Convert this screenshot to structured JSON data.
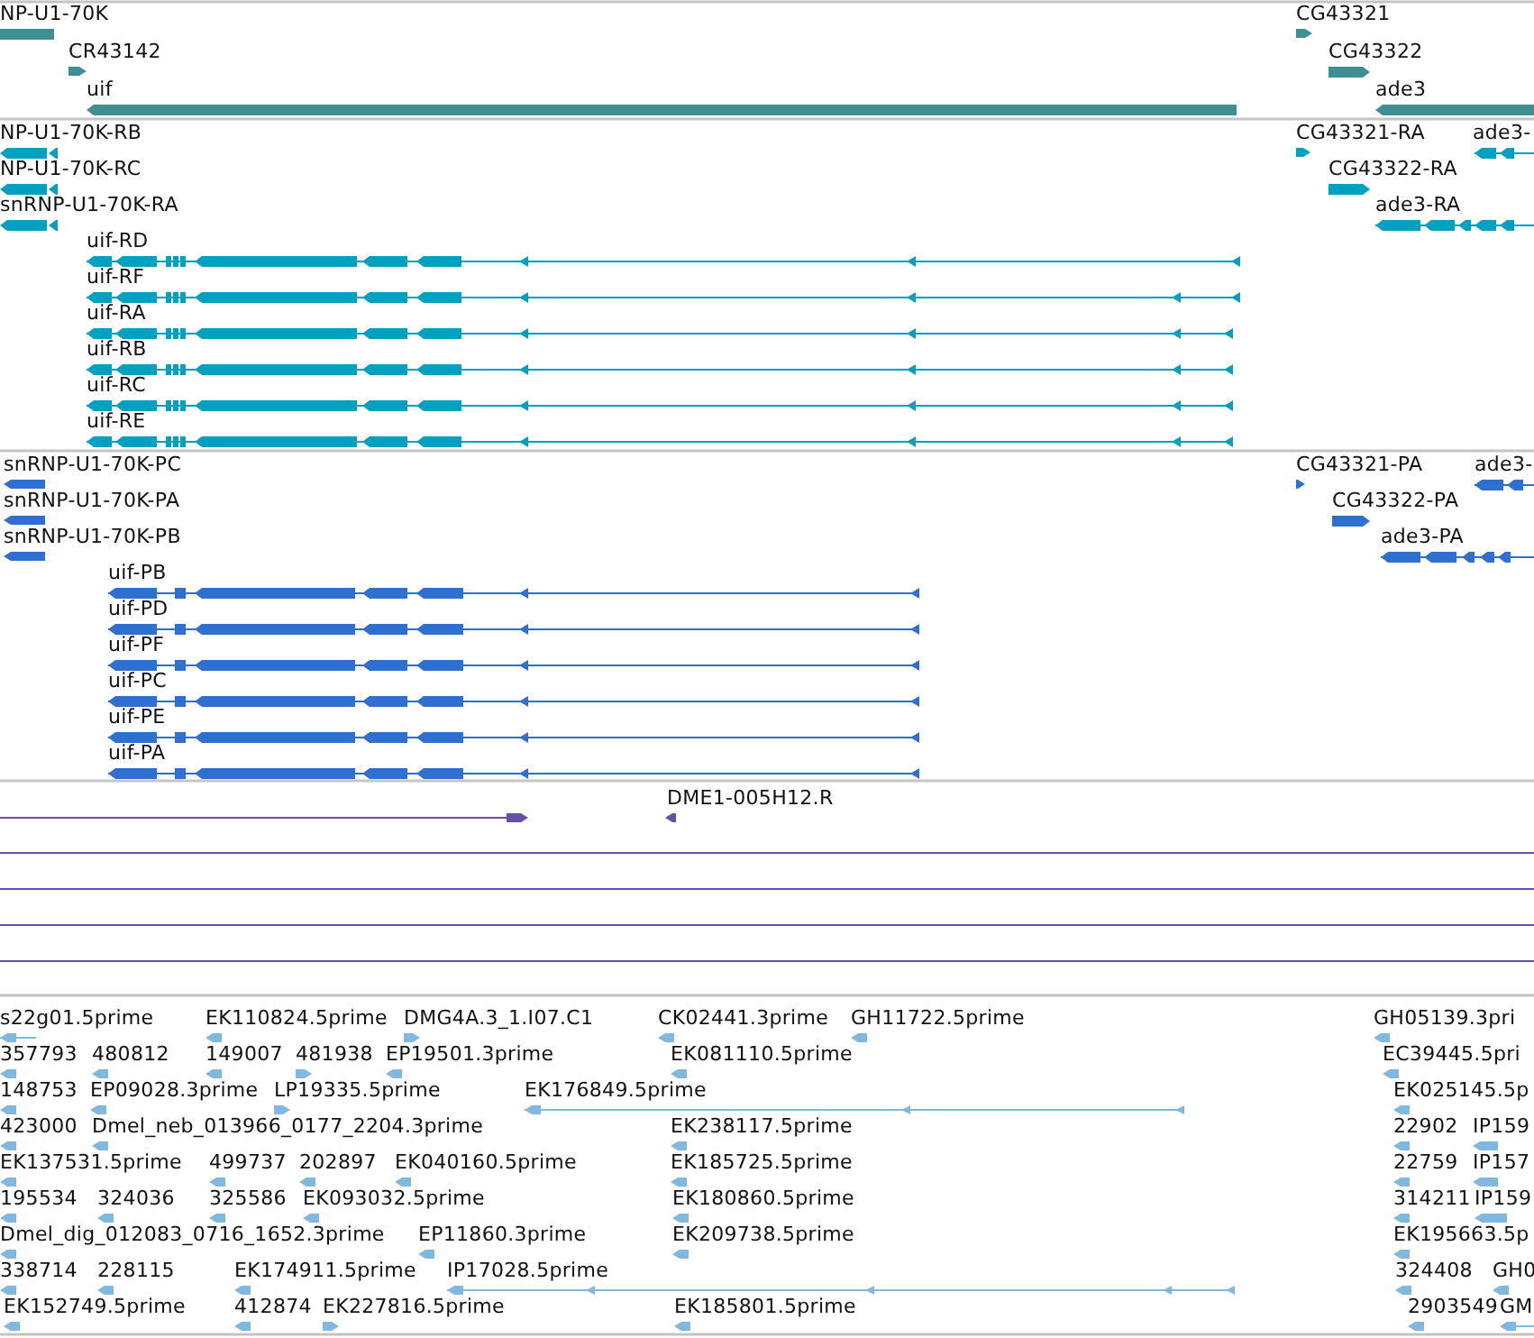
{
  "tracks": [
    {
      "kind": "gene",
      "features": [
        {
          "label": "NP-U1-70K"
        },
        {
          "label": "CR43142"
        },
        {
          "label": "uif"
        },
        {
          "label": "CG43321"
        },
        {
          "label": "CG43322"
        },
        {
          "label": "ade3"
        }
      ]
    },
    {
      "kind": "transcript",
      "features": [
        {
          "label": "NP-U1-70K-RB"
        },
        {
          "label": "NP-U1-70K-RC"
        },
        {
          "label": "snRNP-U1-70K-RA"
        },
        {
          "label": "uif-RD"
        },
        {
          "label": "uif-RF"
        },
        {
          "label": "uif-RA"
        },
        {
          "label": "uif-RB"
        },
        {
          "label": "uif-RC"
        },
        {
          "label": "uif-RE"
        },
        {
          "label": "CG43321-RA"
        },
        {
          "label": "ade3-"
        },
        {
          "label": "CG43322-RA"
        },
        {
          "label": "ade3-RA"
        }
      ]
    },
    {
      "kind": "protein",
      "features": [
        {
          "label": "snRNP-U1-70K-PC"
        },
        {
          "label": "snRNP-U1-70K-PA"
        },
        {
          "label": "snRNP-U1-70K-PB"
        },
        {
          "label": "uif-PB"
        },
        {
          "label": "uif-PD"
        },
        {
          "label": "uif-PF"
        },
        {
          "label": "uif-PC"
        },
        {
          "label": "uif-PE"
        },
        {
          "label": "uif-PA"
        },
        {
          "label": "CG43321-PA"
        },
        {
          "label": "ade3-"
        },
        {
          "label": "CG43322-PA"
        },
        {
          "label": "ade3-PA"
        }
      ]
    },
    {
      "kind": "clone",
      "features": [
        {
          "label": "DME1-005H12.R"
        }
      ]
    },
    {
      "kind": "est",
      "features": [
        {
          "label": "s22g01.5prime"
        },
        {
          "label": "EK110824.5prime"
        },
        {
          "label": "DMG4A.3_1.I07.C1"
        },
        {
          "label": "CK02441.3prime"
        },
        {
          "label": "GH11722.5prime"
        },
        {
          "label": "GH05139.3pri"
        },
        {
          "label": "357793"
        },
        {
          "label": "480812"
        },
        {
          "label": "149007"
        },
        {
          "label": "481938"
        },
        {
          "label": "EP19501.3prime"
        },
        {
          "label": "EK081110.5prime"
        },
        {
          "label": "EC39445.5pri"
        },
        {
          "label": "148753"
        },
        {
          "label": "EP09028.3prime"
        },
        {
          "label": "LP19335.5prime"
        },
        {
          "label": "EK176849.5prime"
        },
        {
          "label": "EK025145.5p"
        },
        {
          "label": "423000"
        },
        {
          "label": "Dmel_neb_013966_0177_2204.3prime"
        },
        {
          "label": "EK238117.5prime"
        },
        {
          "label": "22902"
        },
        {
          "label": "IP159"
        },
        {
          "label": "EK137531.5prime"
        },
        {
          "label": "499737"
        },
        {
          "label": "202897"
        },
        {
          "label": "EK040160.5prime"
        },
        {
          "label": "EK185725.5prime"
        },
        {
          "label": "22759"
        },
        {
          "label": "IP157"
        },
        {
          "label": "195534"
        },
        {
          "label": "324036"
        },
        {
          "label": "325586"
        },
        {
          "label": "EK093032.5prime"
        },
        {
          "label": "EK180860.5prime"
        },
        {
          "label": "314211"
        },
        {
          "label": "IP159"
        },
        {
          "label": "Dmel_dig_012083_0716_1652.3prime"
        },
        {
          "label": "EP11860.3prime"
        },
        {
          "label": "EK209738.5prime"
        },
        {
          "label": "EK195663.5p"
        },
        {
          "label": "338714"
        },
        {
          "label": "228115"
        },
        {
          "label": "EK174911.5prime"
        },
        {
          "label": "IP17028.5prime"
        },
        {
          "label": "324408"
        },
        {
          "label": "GH0"
        },
        {
          "label": "EK152749.5prime"
        },
        {
          "label": "412874"
        },
        {
          "label": "EK227816.5prime"
        },
        {
          "label": "EK185801.5prime"
        },
        {
          "label": "2903549"
        },
        {
          "label": "GM"
        }
      ]
    }
  ]
}
